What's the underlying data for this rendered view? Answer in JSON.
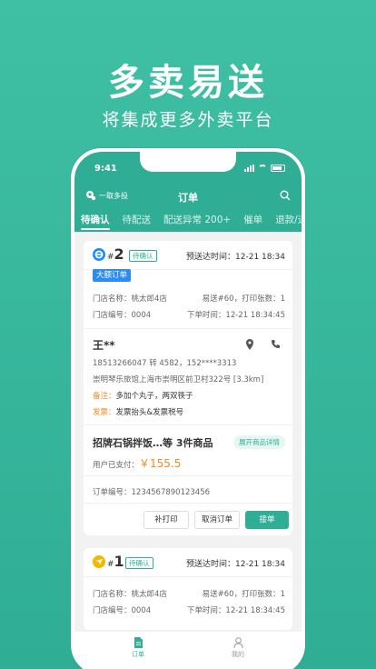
{
  "promo": {
    "title": "多卖易送",
    "subtitle": "将集成更多外卖平台"
  },
  "status": {
    "time": "9:41"
  },
  "nav": {
    "left_label": "一取多投",
    "title": "订单"
  },
  "tabs": [
    {
      "label": "待确认",
      "active": true
    },
    {
      "label": "待配送"
    },
    {
      "label": "配送异常 200+"
    },
    {
      "label": "催单"
    },
    {
      "label": "退款/退"
    }
  ],
  "order1": {
    "number": "2",
    "status_badge": "待确认",
    "delivery_time": "预送达时间：12-21 18:34",
    "big_order_badge": "大额订单",
    "store_name": "门店名称：桃太郎4店",
    "order_serial": "易送#60，打印张数：1",
    "store_code": "门店编号：0004",
    "order_time": "下单时间：12-21 18:34:45",
    "customer_name": "王**",
    "phone": "18513266047 转 4582，152****3313",
    "address": "崇明琴乐旅馆上海市崇明区前卫村322号 [3.3km]",
    "note_label": "备注：",
    "note_value": "多加个丸子，两双筷子",
    "invoice_label": "发票：",
    "invoice_value": "发票抬头&发票税号",
    "goods_summary": "招牌石锅拌饭…等 3件商品",
    "expand_label": "展开商品详情",
    "paid_label": "用户已支付：",
    "paid_amount": "￥155.5",
    "order_id": "订单编号：1234567890123456",
    "btn_print": "补打印",
    "btn_cancel": "取消订单",
    "btn_accept": "接单"
  },
  "order2": {
    "number": "1",
    "status_badge": "待确认",
    "delivery_time": "预送达时间：12-21 18:34",
    "store_name": "门店名称：桃太郎4店",
    "order_serial": "易送#60，打印张数：1",
    "store_code": "门店编号：0004",
    "order_time": "下单时间：12-21 18:34:45"
  },
  "bottom_nav": [
    {
      "label": "订单",
      "active": true
    },
    {
      "label": "我的"
    }
  ],
  "colors": {
    "brand": "#2fae95",
    "accent_orange": "#f5871f",
    "badge_blue": "#2d8cf0"
  }
}
